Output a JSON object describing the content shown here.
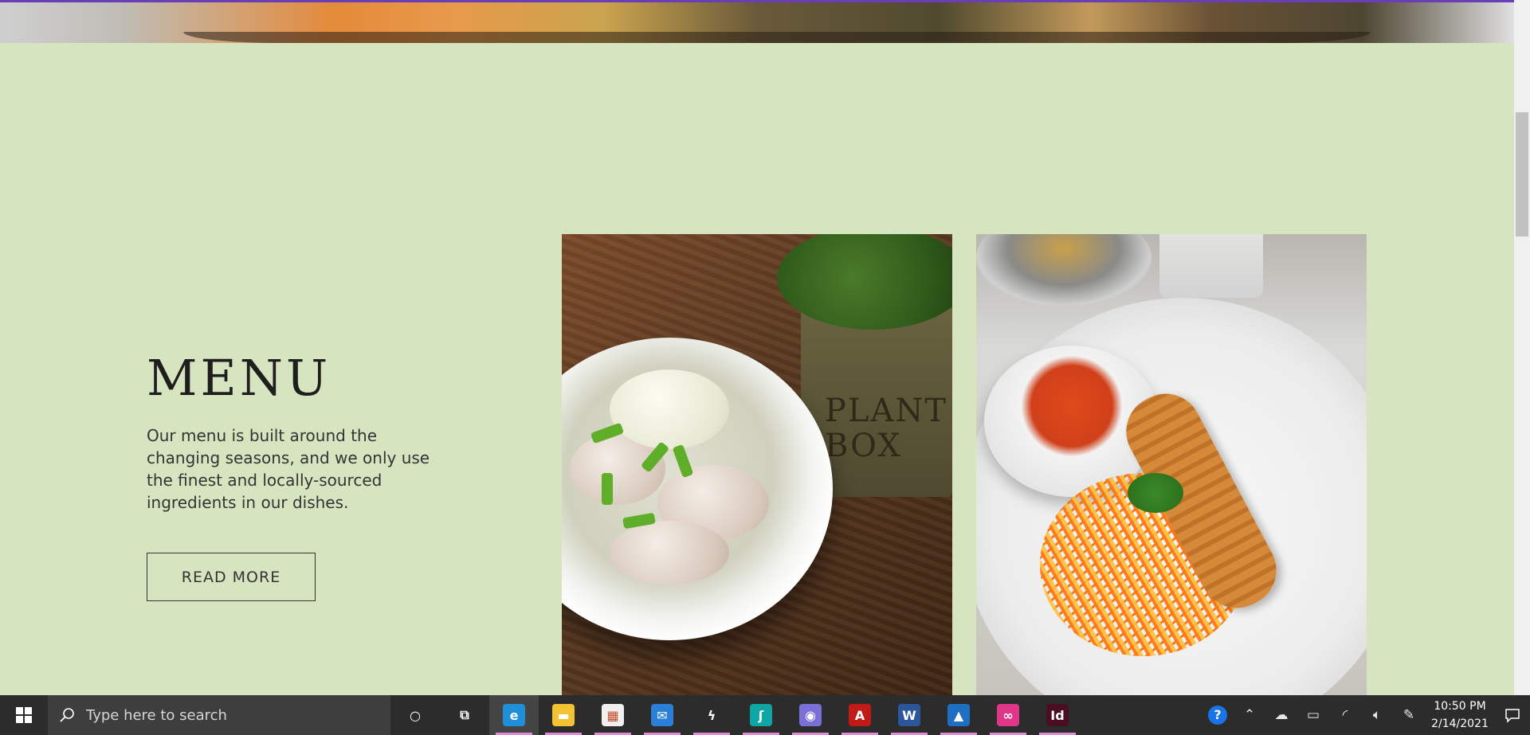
{
  "menu": {
    "title": "MENU",
    "description": "Our menu is built around the changing seasons, and we only use the finest and locally-sourced ingredients in our dishes.",
    "read_more_label": "READ MORE"
  },
  "photos": {
    "photo1_box_text": "PLANT BOX"
  },
  "taskbar": {
    "search_placeholder": "Type here to search",
    "pinned_apps": [
      {
        "name": "cortana-icon",
        "glyph": "○",
        "color": "transparent"
      },
      {
        "name": "task-view-icon",
        "glyph": "⧉",
        "color": "transparent"
      },
      {
        "name": "edge-icon",
        "glyph": "e",
        "color": "#1f8fd8",
        "active": true
      },
      {
        "name": "file-explorer-icon",
        "glyph": "▬",
        "color": "#f3c230"
      },
      {
        "name": "store-icon",
        "glyph": "▦",
        "color": "#f0f0f0"
      },
      {
        "name": "mail-icon",
        "glyph": "✉",
        "color": "#2a7fd8"
      },
      {
        "name": "app-bolt-icon",
        "glyph": "ϟ",
        "color": "transparent"
      },
      {
        "name": "sway-icon",
        "glyph": "ʃ",
        "color": "#0ea5a5"
      },
      {
        "name": "camera-app-icon",
        "glyph": "◉",
        "color": "#7b6fd8"
      },
      {
        "name": "acrobat-icon",
        "glyph": "A",
        "color": "#c21b17"
      },
      {
        "name": "word-icon",
        "glyph": "W",
        "color": "#2b579a"
      },
      {
        "name": "photos-icon",
        "glyph": "▲",
        "color": "#1e6fc2"
      },
      {
        "name": "creative-cloud-icon",
        "glyph": "∞",
        "color": "#e0368a"
      },
      {
        "name": "indesign-icon",
        "glyph": "Id",
        "color": "#4a0d22"
      }
    ],
    "clock_time": "10:50 PM",
    "clock_date": "2/14/2021"
  },
  "colors": {
    "section_bg": "#d7e4c0",
    "accent_line": "#6a3fb5",
    "taskbar_bg": "#2c2c2c"
  }
}
